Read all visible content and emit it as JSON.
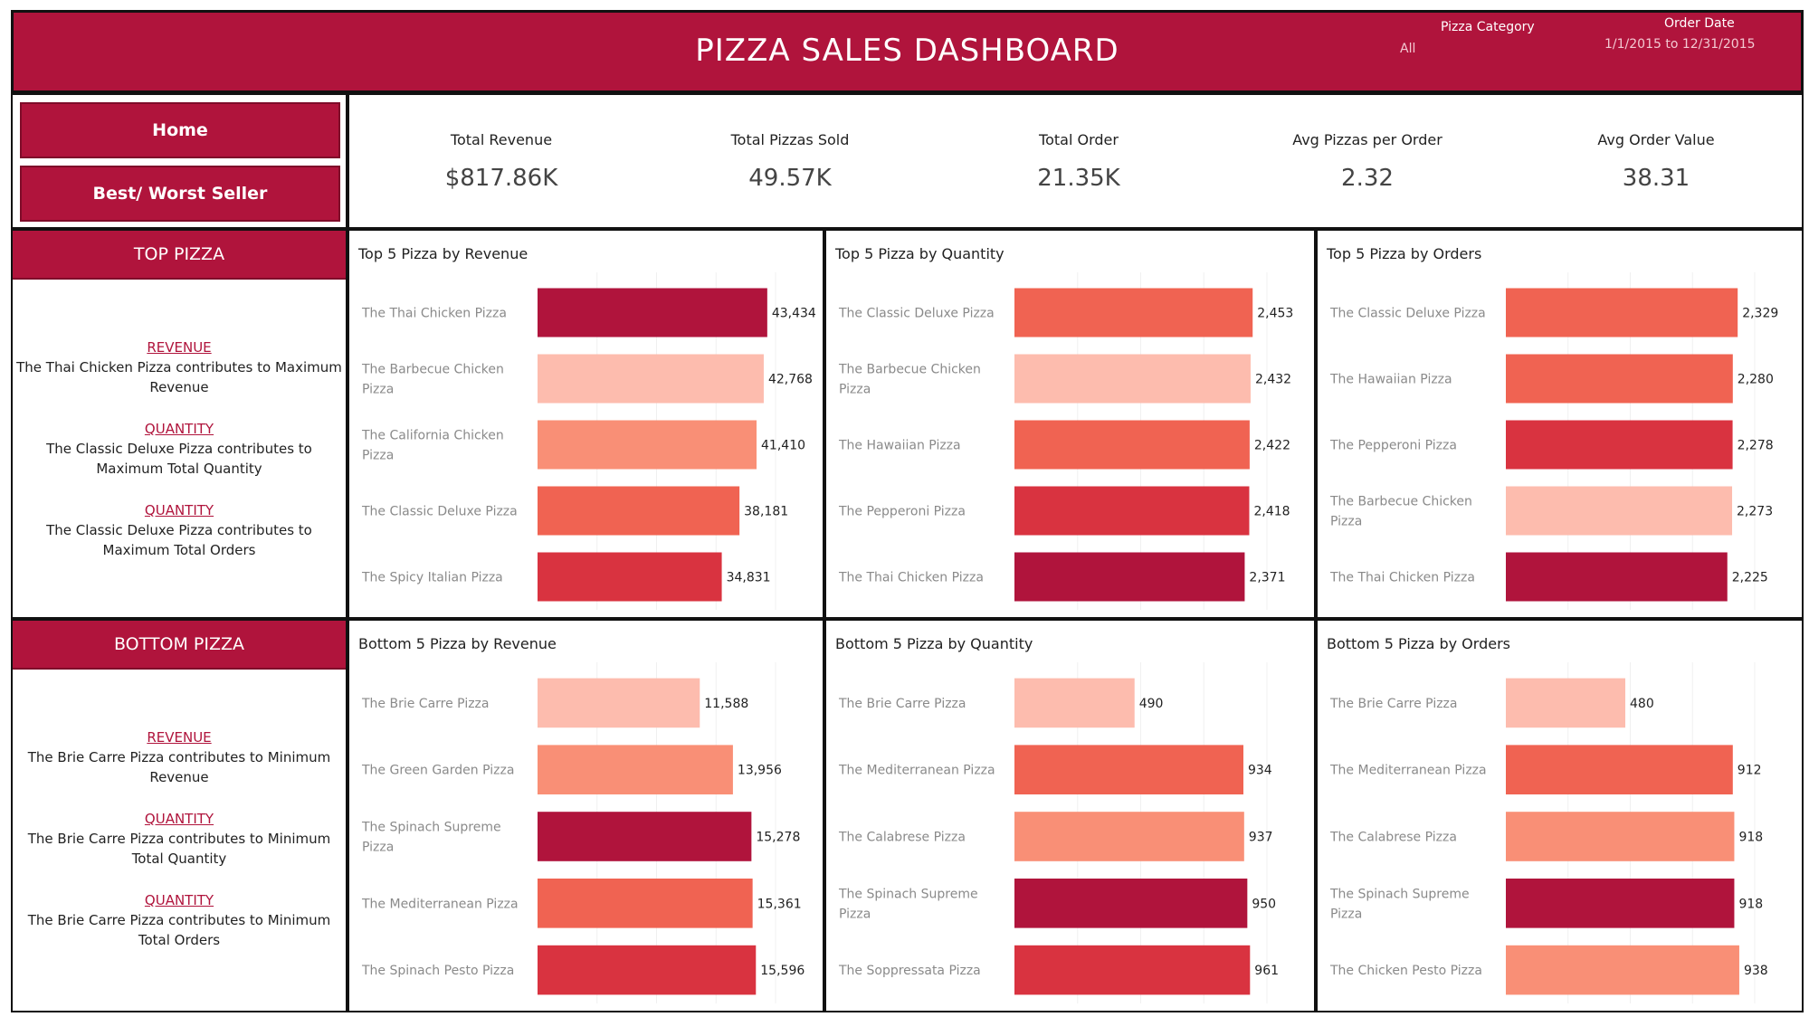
{
  "header": {
    "title": "PIZZA SALES DASHBOARD",
    "filter_category_label": "Pizza Category",
    "filter_category_value": "All",
    "filter_date_label": "Order Date",
    "filter_date_value": "1/1/2015 to 12/31/2015"
  },
  "nav": {
    "home_label": "Home",
    "best_worst_label": "Best/ Worst Seller"
  },
  "kpis": [
    {
      "label": "Total Revenue",
      "value": "$817.86K"
    },
    {
      "label": "Total Pizzas Sold",
      "value": "49.57K"
    },
    {
      "label": "Total Order",
      "value": "21.35K"
    },
    {
      "label": "Avg Pizzas per Order",
      "value": "2.32"
    },
    {
      "label": "Avg Order Value",
      "value": "38.31"
    }
  ],
  "top_panel": {
    "title": "TOP PIZZA",
    "insights": [
      {
        "metric": "REVENUE",
        "text": "The Thai Chicken Pizza contributes to Maximum Revenue"
      },
      {
        "metric": "QUANTITY",
        "text": "The Classic Deluxe Pizza contributes to Maximum Total Quantity"
      },
      {
        "metric": "QUANTITY",
        "text": "The Classic Deluxe Pizza contributes to Maximum Total Orders"
      }
    ]
  },
  "bottom_panel": {
    "title": "BOTTOM PIZZA",
    "insights": [
      {
        "metric": "REVENUE",
        "text": "The Brie Carre Pizza contributes to Minimum Revenue"
      },
      {
        "metric": "QUANTITY",
        "text": "The Brie Carre Pizza contributes to Minimum Total Quantity"
      },
      {
        "metric": "QUANTITY",
        "text": "The Brie Carre Pizza contributes to Minimum Total Orders"
      }
    ]
  },
  "colors": {
    "brand": "#b0143c",
    "shade_darkest": "#b0143c",
    "shade_dark": "#d93340",
    "shade_mid": "#f06352",
    "shade_light": "#f98f76",
    "shade_lightest": "#fdbcae"
  },
  "chart_data": [
    {
      "type": "bar",
      "orientation": "horizontal",
      "title": "Top 5 Pizza by Revenue",
      "xlim": [
        0,
        45000
      ],
      "categories": [
        "The Thai Chicken Pizza",
        "The Barbecue Chicken Pizza",
        "The California Chicken Pizza",
        "The Classic Deluxe Pizza",
        "The Spicy Italian Pizza"
      ],
      "values": [
        43434,
        42768,
        41410,
        38181,
        34831
      ],
      "labels": [
        "43,434",
        "42,768",
        "41,410",
        "38,181",
        "34,831"
      ],
      "colors": [
        "#b0143c",
        "#fdbcae",
        "#f98f76",
        "#f06352",
        "#d93340"
      ]
    },
    {
      "type": "bar",
      "orientation": "horizontal",
      "title": "Top 5 Pizza by Quantity",
      "xlim": [
        0,
        2600
      ],
      "categories": [
        "The Classic Deluxe Pizza",
        "The Barbecue Chicken Pizza",
        "The Hawaiian Pizza",
        "The Pepperoni Pizza",
        "The Thai Chicken Pizza"
      ],
      "values": [
        2453,
        2432,
        2422,
        2418,
        2371
      ],
      "labels": [
        "2,453",
        "2,432",
        "2,422",
        "2,418",
        "2,371"
      ],
      "colors": [
        "#f06352",
        "#fdbcae",
        "#f06352",
        "#d93340",
        "#b0143c"
      ]
    },
    {
      "type": "bar",
      "orientation": "horizontal",
      "title": "Top 5 Pizza by Orders",
      "xlim": [
        0,
        2500
      ],
      "categories": [
        "The Classic Deluxe Pizza",
        "The Hawaiian Pizza",
        "The Pepperoni Pizza",
        "The Barbecue Chicken Pizza",
        "The Thai Chicken Pizza"
      ],
      "values": [
        2329,
        2280,
        2278,
        2273,
        2225
      ],
      "labels": [
        "2,329",
        "2,280",
        "2,278",
        "2,273",
        "2,225"
      ],
      "colors": [
        "#f06352",
        "#f06352",
        "#d93340",
        "#fdbcae",
        "#b0143c"
      ]
    },
    {
      "type": "bar",
      "orientation": "horizontal",
      "title": "Bottom 5 Pizza by Revenue",
      "xlim": [
        0,
        17000
      ],
      "categories": [
        "The Brie Carre Pizza",
        "The Green Garden Pizza",
        "The Spinach Supreme Pizza",
        "The Mediterranean Pizza",
        "The Spinach Pesto Pizza"
      ],
      "values": [
        11588,
        13956,
        15278,
        15361,
        15596
      ],
      "labels": [
        "11,588",
        "13,956",
        "15,278",
        "15,361",
        "15,596"
      ],
      "colors": [
        "#fdbcae",
        "#f98f76",
        "#b0143c",
        "#f06352",
        "#d93340"
      ]
    },
    {
      "type": "bar",
      "orientation": "horizontal",
      "title": "Bottom 5 Pizza by Quantity",
      "xlim": [
        0,
        1030
      ],
      "categories": [
        "The Brie Carre Pizza",
        "The Mediterranean Pizza",
        "The Calabrese Pizza",
        "The Spinach Supreme Pizza",
        "The Soppressata Pizza"
      ],
      "values": [
        490,
        934,
        937,
        950,
        961
      ],
      "labels": [
        "490",
        "934",
        "937",
        "950",
        "961"
      ],
      "colors": [
        "#fdbcae",
        "#f06352",
        "#f98f76",
        "#b0143c",
        "#d93340"
      ]
    },
    {
      "type": "bar",
      "orientation": "horizontal",
      "title": "Bottom 5 Pizza by Orders",
      "xlim": [
        0,
        1000
      ],
      "categories": [
        "The Brie Carre Pizza",
        "The Mediterranean Pizza",
        "The Calabrese Pizza",
        "The Spinach Supreme Pizza",
        "The Chicken Pesto Pizza"
      ],
      "values": [
        480,
        912,
        918,
        918,
        938
      ],
      "labels": [
        "480",
        "912",
        "918",
        "918",
        "938"
      ],
      "colors": [
        "#fdbcae",
        "#f06352",
        "#f98f76",
        "#b0143c",
        "#f98f76"
      ]
    }
  ]
}
